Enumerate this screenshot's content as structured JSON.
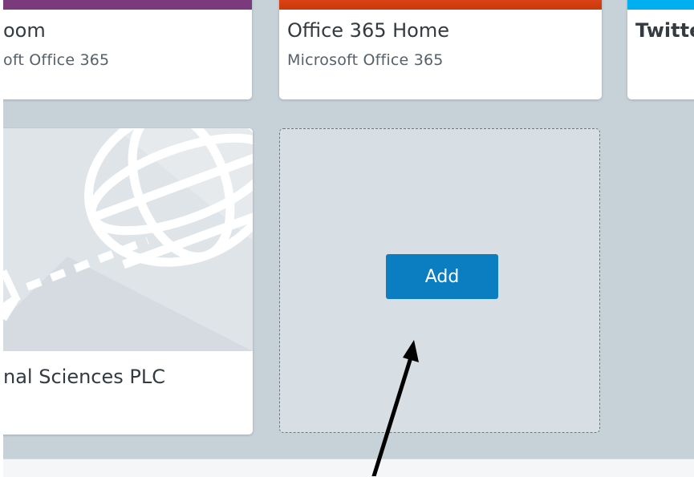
{
  "colors": {
    "tile_bar_purple": "#7b3a7b",
    "tile_bar_orange": "#d83b01",
    "tile_bar_blue": "#00aff0",
    "add_button": "#0b7dc1",
    "canvas_background": "#c6d1d8"
  },
  "tiles": [
    {
      "title": "oom",
      "subtitle": "oft Office 365"
    },
    {
      "title": "Office 365 Home",
      "subtitle": "Microsoft Office 365"
    },
    {
      "title": "Twitte",
      "subtitle": ""
    },
    {
      "title": "nal Sciences PLC",
      "subtitle": "",
      "image_icon": "globe-network-illustration"
    }
  ],
  "add_tile": {
    "button_label": "Add"
  },
  "annotation": {
    "icon": "arrow-pointer-icon"
  }
}
